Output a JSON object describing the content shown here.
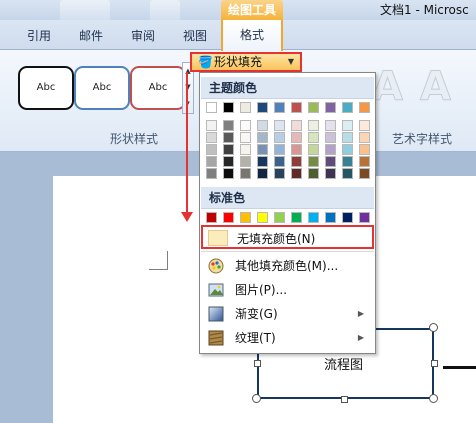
{
  "titlebar": {
    "context_group": "绘图工具",
    "doc_title": "文档1 - Microsc"
  },
  "ribbon_tabs": [
    {
      "label": "引用"
    },
    {
      "label": "邮件"
    },
    {
      "label": "审阅"
    },
    {
      "label": "视图"
    },
    {
      "label": "格式",
      "active": true
    }
  ],
  "ribbon": {
    "shape_style_sample": "Abc",
    "shape_styles_group": "形状样式",
    "wordart_group": "艺术字样式",
    "wordart_sample": "A",
    "fill_button": "形状填充",
    "colors": {
      "accent_red": "#e53333",
      "context_orange": "#f6b23a"
    }
  },
  "menu": {
    "theme_colors_header": "主题颜色",
    "standard_colors_header": "标准色",
    "theme_colors": [
      "#ffffff",
      "#000000",
      "#eeece1",
      "#1f497d",
      "#4f81bd",
      "#c0504d",
      "#9bbb59",
      "#8064a2",
      "#4bacc6",
      "#f79646"
    ],
    "standard_colors": [
      "#c00000",
      "#ff0000",
      "#ffc000",
      "#ffff00",
      "#92d050",
      "#00b050",
      "#00b0f0",
      "#0070c0",
      "#002060",
      "#7030a0"
    ],
    "items": [
      {
        "label": "无填充颜色(N)",
        "icon": "no-fill-swatch"
      },
      {
        "label": "其他填充颜色(M)...",
        "icon": "palette-icon"
      },
      {
        "label": "图片(P)...",
        "icon": "picture-icon"
      },
      {
        "label": "渐变(G)",
        "icon": "gradient-icon",
        "submenu": true
      },
      {
        "label": "纹理(T)",
        "icon": "texture-icon",
        "submenu": true
      }
    ]
  },
  "document": {
    "flowchart_label": "流程图"
  }
}
